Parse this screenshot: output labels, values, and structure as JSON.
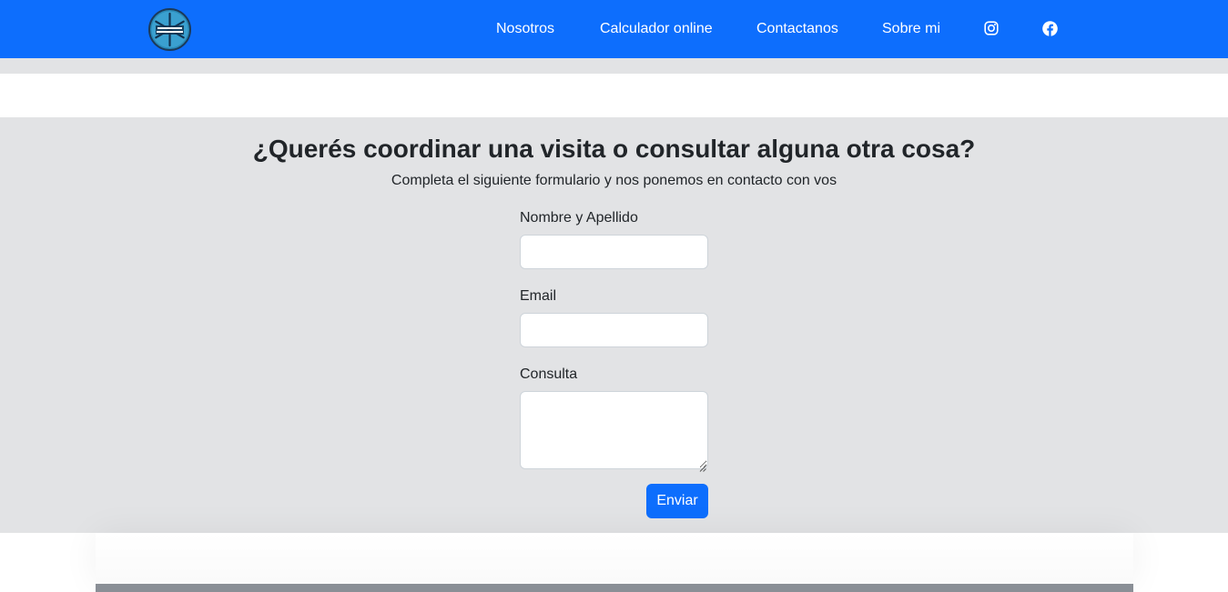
{
  "navbar": {
    "logo_icon": "snowflake-logo-icon",
    "links": [
      {
        "label": "Nosotros"
      },
      {
        "label": "Calculador online"
      },
      {
        "label": "Contactanos"
      },
      {
        "label": "Sobre mi"
      }
    ],
    "social_icons": [
      "instagram-icon",
      "facebook-icon"
    ],
    "background_color": "#0d6efd"
  },
  "contact": {
    "title": "¿Querés coordinar una visita o consultar alguna otra cosa?",
    "subtitle": "Completa el siguiente formulario y nos ponemos en contacto con vos",
    "fields": {
      "name": {
        "label": "Nombre y Apellido",
        "value": ""
      },
      "email": {
        "label": "Email",
        "value": ""
      },
      "message": {
        "label": "Consulta",
        "value": ""
      }
    },
    "submit_label": "Enviar",
    "background_color": "#e2e3e5"
  }
}
